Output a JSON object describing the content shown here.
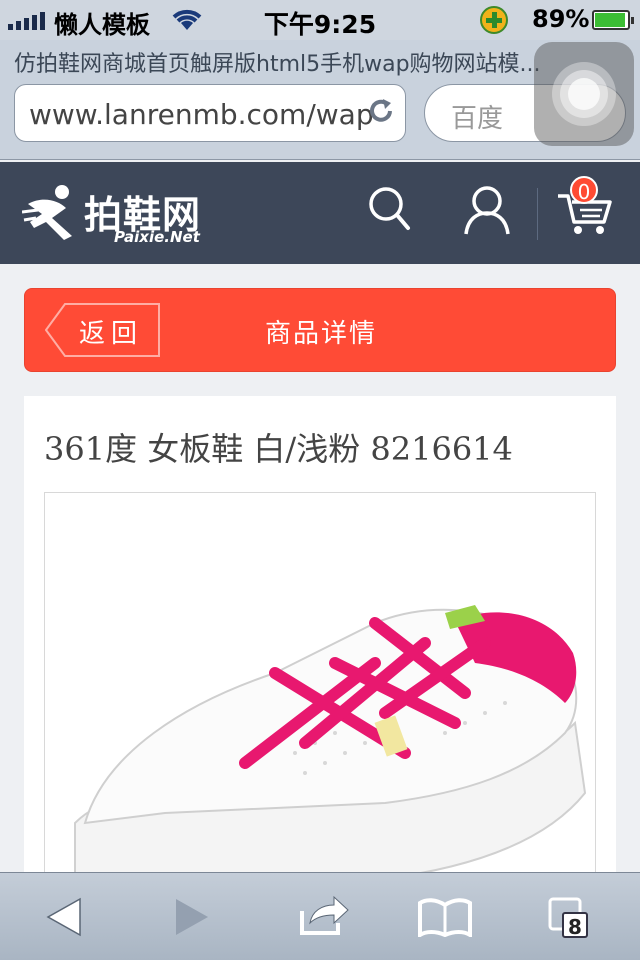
{
  "status_bar": {
    "carrier": "懒人模板",
    "time": "下午9:25",
    "battery_percent": "89%",
    "battery_level": 0.89
  },
  "browser": {
    "page_title": "仿拍鞋网商城首页触屏版html5手机wap购物网站模...",
    "url": "www.lanrenmb.com/wap",
    "search_placeholder": "百度"
  },
  "site_header": {
    "logo_text": "拍鞋网",
    "logo_subtext": "Paixie.Net",
    "cart_count": "0"
  },
  "nav": {
    "back_label": "返回",
    "title": "商品详情"
  },
  "product": {
    "name": "361度 女板鞋 白/浅粉 8216614",
    "image_icon": "sneaker-photo"
  },
  "toolbar": {
    "tab_count": "8"
  },
  "colors": {
    "header_bg": "#3d4759",
    "accent": "#ff4b36",
    "page_bg": "#eef0f3"
  }
}
